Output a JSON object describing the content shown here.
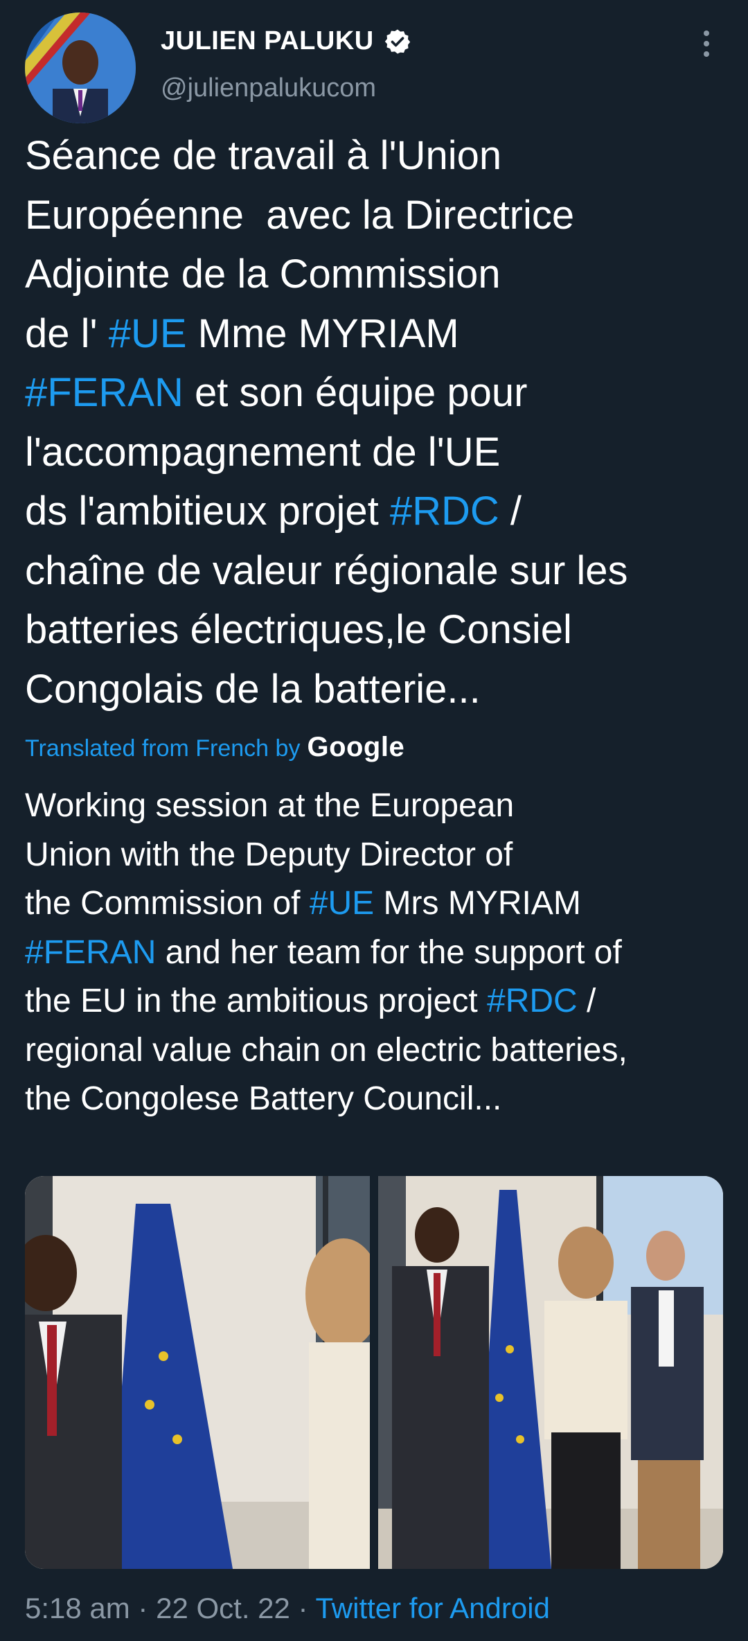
{
  "author": {
    "name": "JULIEN PALUKU",
    "handle": "@julienpalukucom",
    "verified_icon": "verified-badge-icon"
  },
  "tweet": {
    "lines": [
      [
        {
          "t": "Séance de travail à l'Union"
        }
      ],
      [
        {
          "t": "Européenne  avec la Directrice"
        }
      ],
      [
        {
          "t": "Adjointe de la Commission"
        }
      ],
      [
        {
          "t": "de l' "
        },
        {
          "t": "#UE",
          "tag": true
        },
        {
          "t": " Mme MYRIAM"
        }
      ],
      [
        {
          "t": "#FERAN",
          "tag": true
        },
        {
          "t": " et son équipe pour"
        }
      ],
      [
        {
          "t": "l'accompagnement de l'UE"
        }
      ],
      [
        {
          "t": "ds l'ambitieux projet "
        },
        {
          "t": "#RDC",
          "tag": true
        },
        {
          "t": " /"
        }
      ],
      [
        {
          "t": "chaîne de valeur régionale sur les"
        }
      ],
      [
        {
          "t": "batteries électriques,le Consiel"
        }
      ],
      [
        {
          "t": "Congolais de la batterie..."
        }
      ]
    ]
  },
  "translation": {
    "label": "Translated from French by",
    "provider": "Google",
    "lines": [
      [
        {
          "t": "Working session at the European"
        }
      ],
      [
        {
          "t": "Union with the Deputy Director of"
        }
      ],
      [
        {
          "t": "the Commission of "
        },
        {
          "t": "#UE",
          "tag": true
        },
        {
          "t": " Mrs MYRIAM"
        }
      ],
      [
        {
          "t": "#FERAN",
          "tag": true
        },
        {
          "t": " and her team for the support of"
        }
      ],
      [
        {
          "t": "the EU in the ambitious project "
        },
        {
          "t": "#RDC",
          "tag": true
        },
        {
          "t": " /"
        }
      ],
      [
        {
          "t": "regional value chain on electric batteries,"
        }
      ],
      [
        {
          "t": "the Congolese Battery Council..."
        }
      ]
    ]
  },
  "meta": {
    "time": "5:18 am",
    "sep1": " · ",
    "date": "22 Oct. 22",
    "sep2": " · ",
    "source": "Twitter for Android"
  },
  "colors": {
    "background": "#15202b",
    "link": "#1d9bf0",
    "secondary": "#8b98a5"
  }
}
